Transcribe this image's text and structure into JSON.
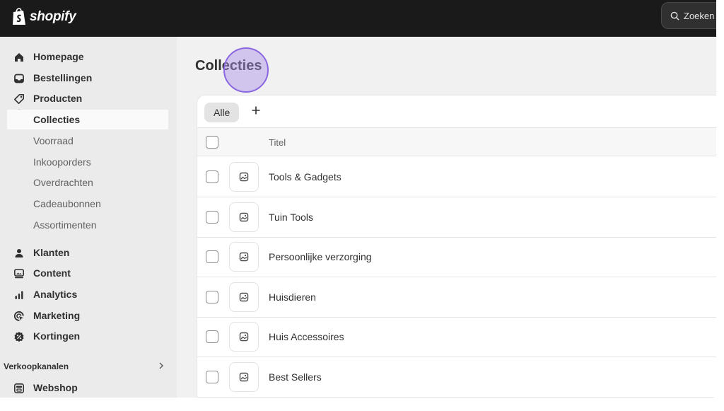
{
  "brand": {
    "name": "shopify",
    "logo_icon": "shopify-bag-icon"
  },
  "search": {
    "placeholder": "Zoeken"
  },
  "sidebar": {
    "items": [
      {
        "label": "Homepage",
        "icon": "home-icon"
      },
      {
        "label": "Bestellingen",
        "icon": "inbox-icon"
      },
      {
        "label": "Producten",
        "icon": "tag-icon"
      },
      {
        "label": "Klanten",
        "icon": "person-icon"
      },
      {
        "label": "Content",
        "icon": "content-icon"
      },
      {
        "label": "Analytics",
        "icon": "bar-chart-icon"
      },
      {
        "label": "Marketing",
        "icon": "target-icon"
      },
      {
        "label": "Kortingen",
        "icon": "discount-icon"
      }
    ],
    "sub_items": [
      {
        "label": "Collecties",
        "active": true
      },
      {
        "label": "Voorraad"
      },
      {
        "label": "Inkooporders"
      },
      {
        "label": "Overdrachten"
      },
      {
        "label": "Cadeaubonnen"
      },
      {
        "label": "Assortimenten"
      }
    ],
    "sales_channels": {
      "heading": "Verkoopkanalen",
      "items": [
        {
          "label": "Webshop",
          "icon": "store-icon"
        }
      ]
    }
  },
  "main": {
    "title": "Collecties",
    "tabs": [
      {
        "label": "Alle",
        "selected": true
      }
    ],
    "table": {
      "header": "Titel",
      "rows": [
        {
          "title": "Tools & Gadgets"
        },
        {
          "title": "Tuin Tools"
        },
        {
          "title": "Persoonlijke verzorging"
        },
        {
          "title": "Huisdieren"
        },
        {
          "title": "Huis Accessoires"
        },
        {
          "title": "Best Sellers"
        }
      ]
    }
  },
  "colors": {
    "topbar": "#1a1a1a",
    "sidebar": "#ebebeb",
    "content_bg": "#f1f1f1",
    "cursor_highlight": "#8a66e0"
  }
}
